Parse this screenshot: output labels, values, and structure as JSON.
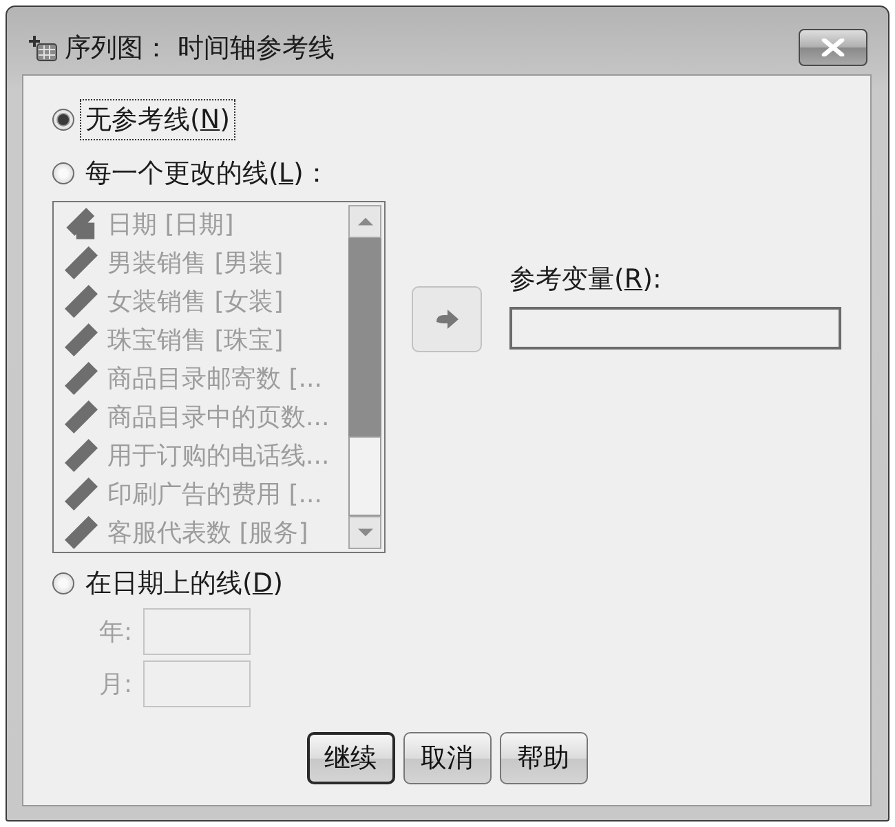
{
  "window": {
    "title": "序列图： 时间轴参考线"
  },
  "reference_options": [
    {
      "label": {
        "before": "无参考线(",
        "key": "N",
        "after": ")"
      },
      "selected": true,
      "focused": true
    },
    {
      "label": {
        "before": "每一个更改的线(",
        "key": "L",
        "after": ")："
      },
      "selected": false,
      "focused": false
    },
    {
      "label": {
        "before": "在日期上的线(",
        "key": "D",
        "after": ")"
      },
      "selected": false,
      "focused": false
    }
  ],
  "variable_list": {
    "disabled": true,
    "items": [
      {
        "kind": "date",
        "name": "日期 [日期]"
      },
      {
        "kind": "scale",
        "name": "男装销售 [男装]"
      },
      {
        "kind": "scale",
        "name": "女装销售 [女装]"
      },
      {
        "kind": "scale",
        "name": "珠宝销售 [珠宝]"
      },
      {
        "kind": "scale",
        "name": "商品目录邮寄数 [..."
      },
      {
        "kind": "scale",
        "name": "商品目录中的页数..."
      },
      {
        "kind": "scale",
        "name": "用于订购的电话线..."
      },
      {
        "kind": "scale",
        "name": "印刷广告的费用 [..."
      },
      {
        "kind": "scale",
        "name": "客服代表数 [服务]"
      }
    ]
  },
  "move_button": {
    "disabled": true
  },
  "reference_variable": {
    "label": {
      "before": "参考变量(",
      "key": "R",
      "after": "):"
    }
  },
  "date_fields": {
    "disabled": true,
    "fields": [
      {
        "label": "年:"
      },
      {
        "label": "月:"
      }
    ]
  },
  "buttons": [
    {
      "label": "继续",
      "default": true
    },
    {
      "label": "取消",
      "default": false
    },
    {
      "label": "帮助",
      "default": false
    }
  ]
}
